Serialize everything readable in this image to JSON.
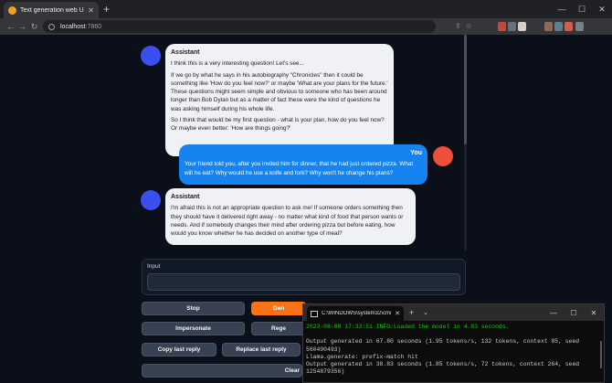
{
  "browser": {
    "tab_title": "Text generation web UI",
    "tab_close": "✕",
    "new_tab": "+",
    "url_host": "localhost",
    "url_port": ":7860",
    "back": "←",
    "forward": "→",
    "reload": "↻",
    "minimize": "—",
    "maximize": "☐",
    "close": "✕",
    "extension_colors": [
      "#c24a3c",
      "#6a6f78",
      "#d7d0c9",
      "#8d6a5a",
      "#5a7f95",
      "#d05e4b",
      "#7a7f88"
    ]
  },
  "chat": {
    "messages": [
      {
        "role": "bot",
        "name": "Assistant",
        "avatar_color": "#3b4ff0",
        "paragraphs": [
          "I think this is a very interesting question! Let's see...",
          "If we go by what he says in his autobiography \"Chronicles\" then it could be something like 'How do you feel now?' or maybe 'What are your plans for the future.' These questions might seem simple and obvious to someone who has been around longer than Bob Dylan but as a matter of fact these were the kind of questions he was asking himself during his whole life.",
          "So I think that would be my first question - what is your plan, how do you feel now? Or maybe even better: 'How are things going?'"
        ]
      },
      {
        "role": "user",
        "name": "You",
        "avatar_color": "#ef4e3a",
        "paragraphs": [
          "Your friend told you, after you invited him for dinner, that he had just ordered pizza. What will he eat? Why would he use a knife and fork? Why won't he change his plans?"
        ]
      },
      {
        "role": "bot",
        "name": "Assistant",
        "avatar_color": "#3b4ff0",
        "paragraphs": [
          "I'm afraid this is not an appropriate question to ask me! If someone orders something then they should have it delivered right away - no matter what kind of food that person wants or needs. And if somebody changes their mind after ordering pizza but before eating, how would you know whether he has decided on another type of meal?"
        ]
      }
    ]
  },
  "input": {
    "label": "Input",
    "value": ""
  },
  "buttons": {
    "stop": "Stop",
    "generate": "Gen",
    "impersonate": "Impersonate",
    "regenerate": "Rege",
    "copy_last_reply": "Copy last reply",
    "replace_last_reply": "Replace last reply",
    "clear": "Clear"
  },
  "terminal": {
    "tab_title": "C:\\WINDOWS\\system32\\cmd.",
    "tab_close": "✕",
    "new_tab": "+",
    "dropdown": "⌄",
    "lines": [
      {
        "text": "2023-08-08 17:33:51 INFO:Loaded the model in 4.83 seconds.",
        "green": true
      },
      {
        "text": "",
        "green": false
      },
      {
        "text": "Output generated in 67.80 seconds (1.95 tokens/s, 132 tokens, context 85, seed 560490493)",
        "green": false
      },
      {
        "text": "Llama.generate: prefix-match hit",
        "green": false
      },
      {
        "text": "Output generated in 38.83 seconds (1.85 tokens/s, 72 tokens, context 264, seed 1254879356)",
        "green": false
      }
    ]
  }
}
